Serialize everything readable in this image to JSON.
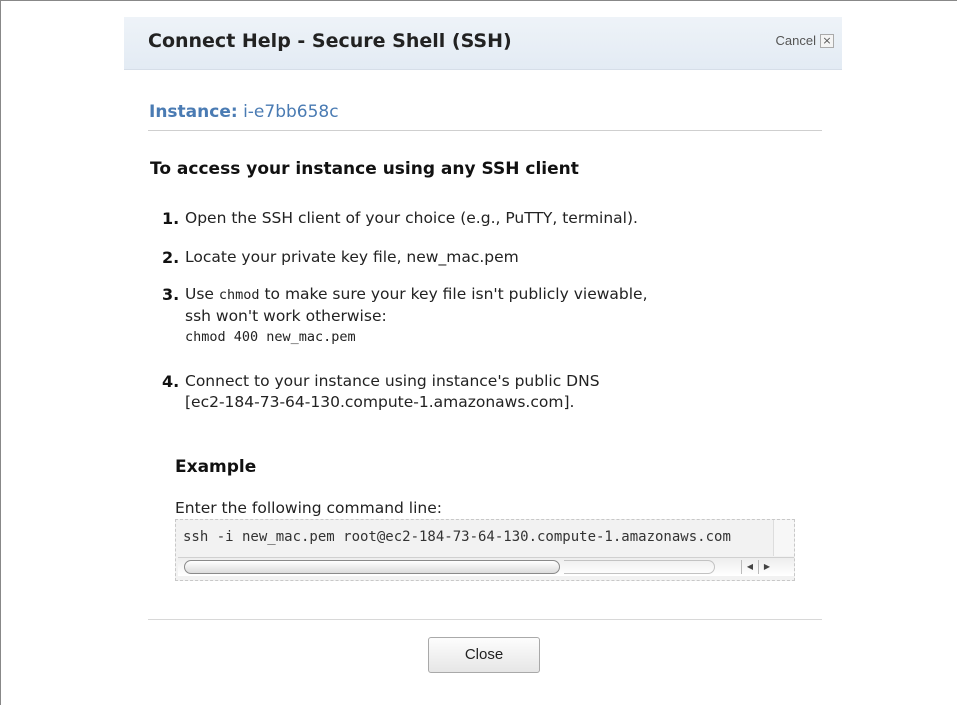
{
  "dialog": {
    "title": "Connect Help - Secure Shell (SSH)",
    "cancel_label": "Cancel",
    "cancel_icon": "×"
  },
  "instance": {
    "label": "Instance:",
    "id": "i-e7bb658c"
  },
  "section_heading": "To access your instance using any SSH client",
  "steps": [
    {
      "num": "1.",
      "line1": "Open the SSH client of your choice (e.g., PuTTY, terminal)."
    },
    {
      "num": "2.",
      "line1": "Locate your private key file, new_mac.pem"
    },
    {
      "num": "3.",
      "line1_pre": "Use ",
      "line1_code": "chmod",
      "line1_post": " to make sure your key file isn't publicly viewable,",
      "line2": "ssh won't work otherwise:",
      "code": "chmod 400 new_mac.pem"
    },
    {
      "num": "4.",
      "line1": "Connect to your instance using instance's public DNS",
      "line2": "[ec2-184-73-64-130.compute-1.amazonaws.com]."
    }
  ],
  "example": {
    "heading": "Example",
    "description": "Enter the following command line:",
    "command": "ssh -i new_mac.pem root@ec2-184-73-64-130.compute-1.amazonaws.com",
    "scroll_left": "◀",
    "scroll_right": "▶"
  },
  "footer": {
    "close_label": "Close"
  },
  "colors": {
    "header_bg": "#e8eef5",
    "instance_color": "#4a7bb3"
  }
}
